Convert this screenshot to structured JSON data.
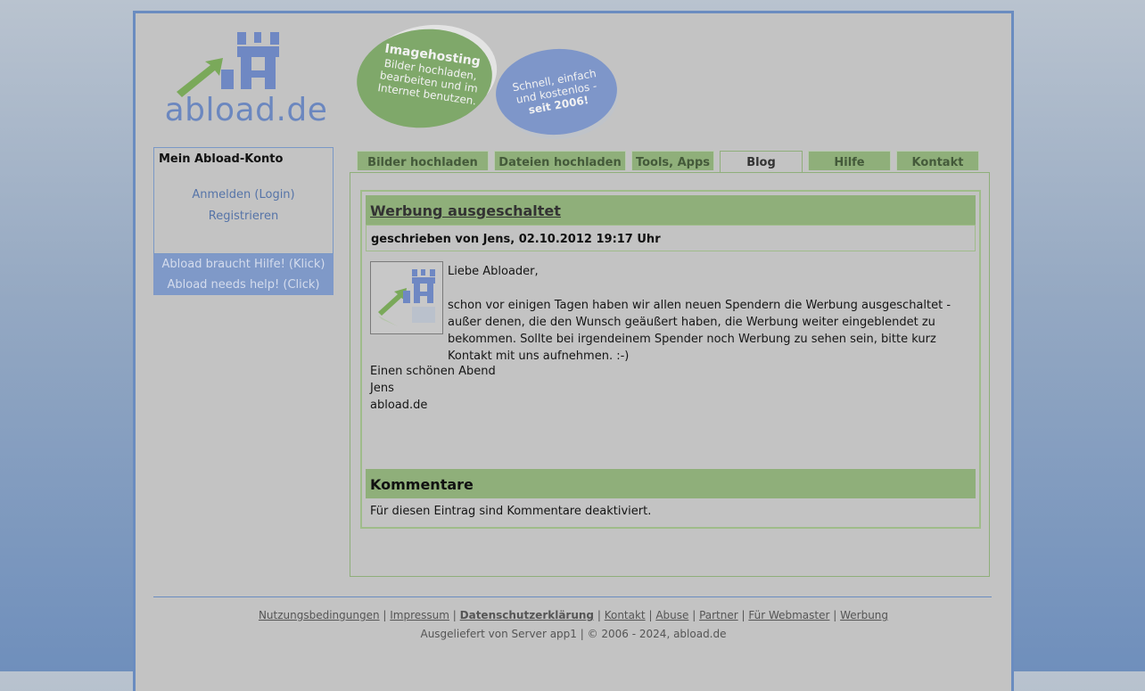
{
  "logo": {
    "text": "abload.de"
  },
  "banner": {
    "green_title": "Imagehosting",
    "green_text": "Bilder hochladen, bearbeiten und im Internet benutzen.",
    "blue_text": "Schnell, einfach und kostenlos -",
    "blue_strong": "seit 2006!"
  },
  "sidebar": {
    "title": "Mein Abload-Konto",
    "login": "Anmelden (Login)",
    "register": "Registrieren",
    "help_de": "Abload braucht Hilfe! (Klick)",
    "help_en": "Abload needs help! (Click)"
  },
  "tabs": [
    {
      "label": "Bilder hochladen"
    },
    {
      "label": "Dateien hochladen"
    },
    {
      "label": "Tools, Apps"
    },
    {
      "label": "Blog",
      "active": true
    },
    {
      "label": "Hilfe"
    },
    {
      "label": "Kontakt"
    }
  ],
  "post": {
    "title": "Werbung ausgeschaltet",
    "meta": "geschrieben von Jens, 02.10.2012 19:17 Uhr",
    "greeting": "Liebe Abloader,",
    "body": "schon vor einigen Tagen haben wir allen neuen Spendern die Werbung ausgeschaltet - außer denen, die den Wunsch geäußert haben, die Werbung weiter eingeblendet zu bekommen. Sollte bei irgendeinem Spender noch Werbung zu sehen sein, bitte kurz Kontakt mit uns aufnehmen. :-)",
    "closing": "Einen schönen Abend",
    "signature_name": "Jens",
    "signature_site": "abload.de"
  },
  "comments": {
    "title": "Kommentare",
    "text": "Für diesen Eintrag sind Kommentare deaktiviert."
  },
  "footer": {
    "links": [
      "Nutzungsbedingungen",
      "Impressum",
      "Datenschutzerklärung",
      "Kontakt",
      "Abuse",
      "Partner",
      "Für Webmaster",
      "Werbung"
    ],
    "server": "Ausgeliefert von Server app1 | © 2006 - 2024, abload.de"
  },
  "colors": {
    "accent_green": "#8faf7a",
    "accent_blue": "#6a8cc0",
    "page_bg": "#c3c3c3"
  }
}
